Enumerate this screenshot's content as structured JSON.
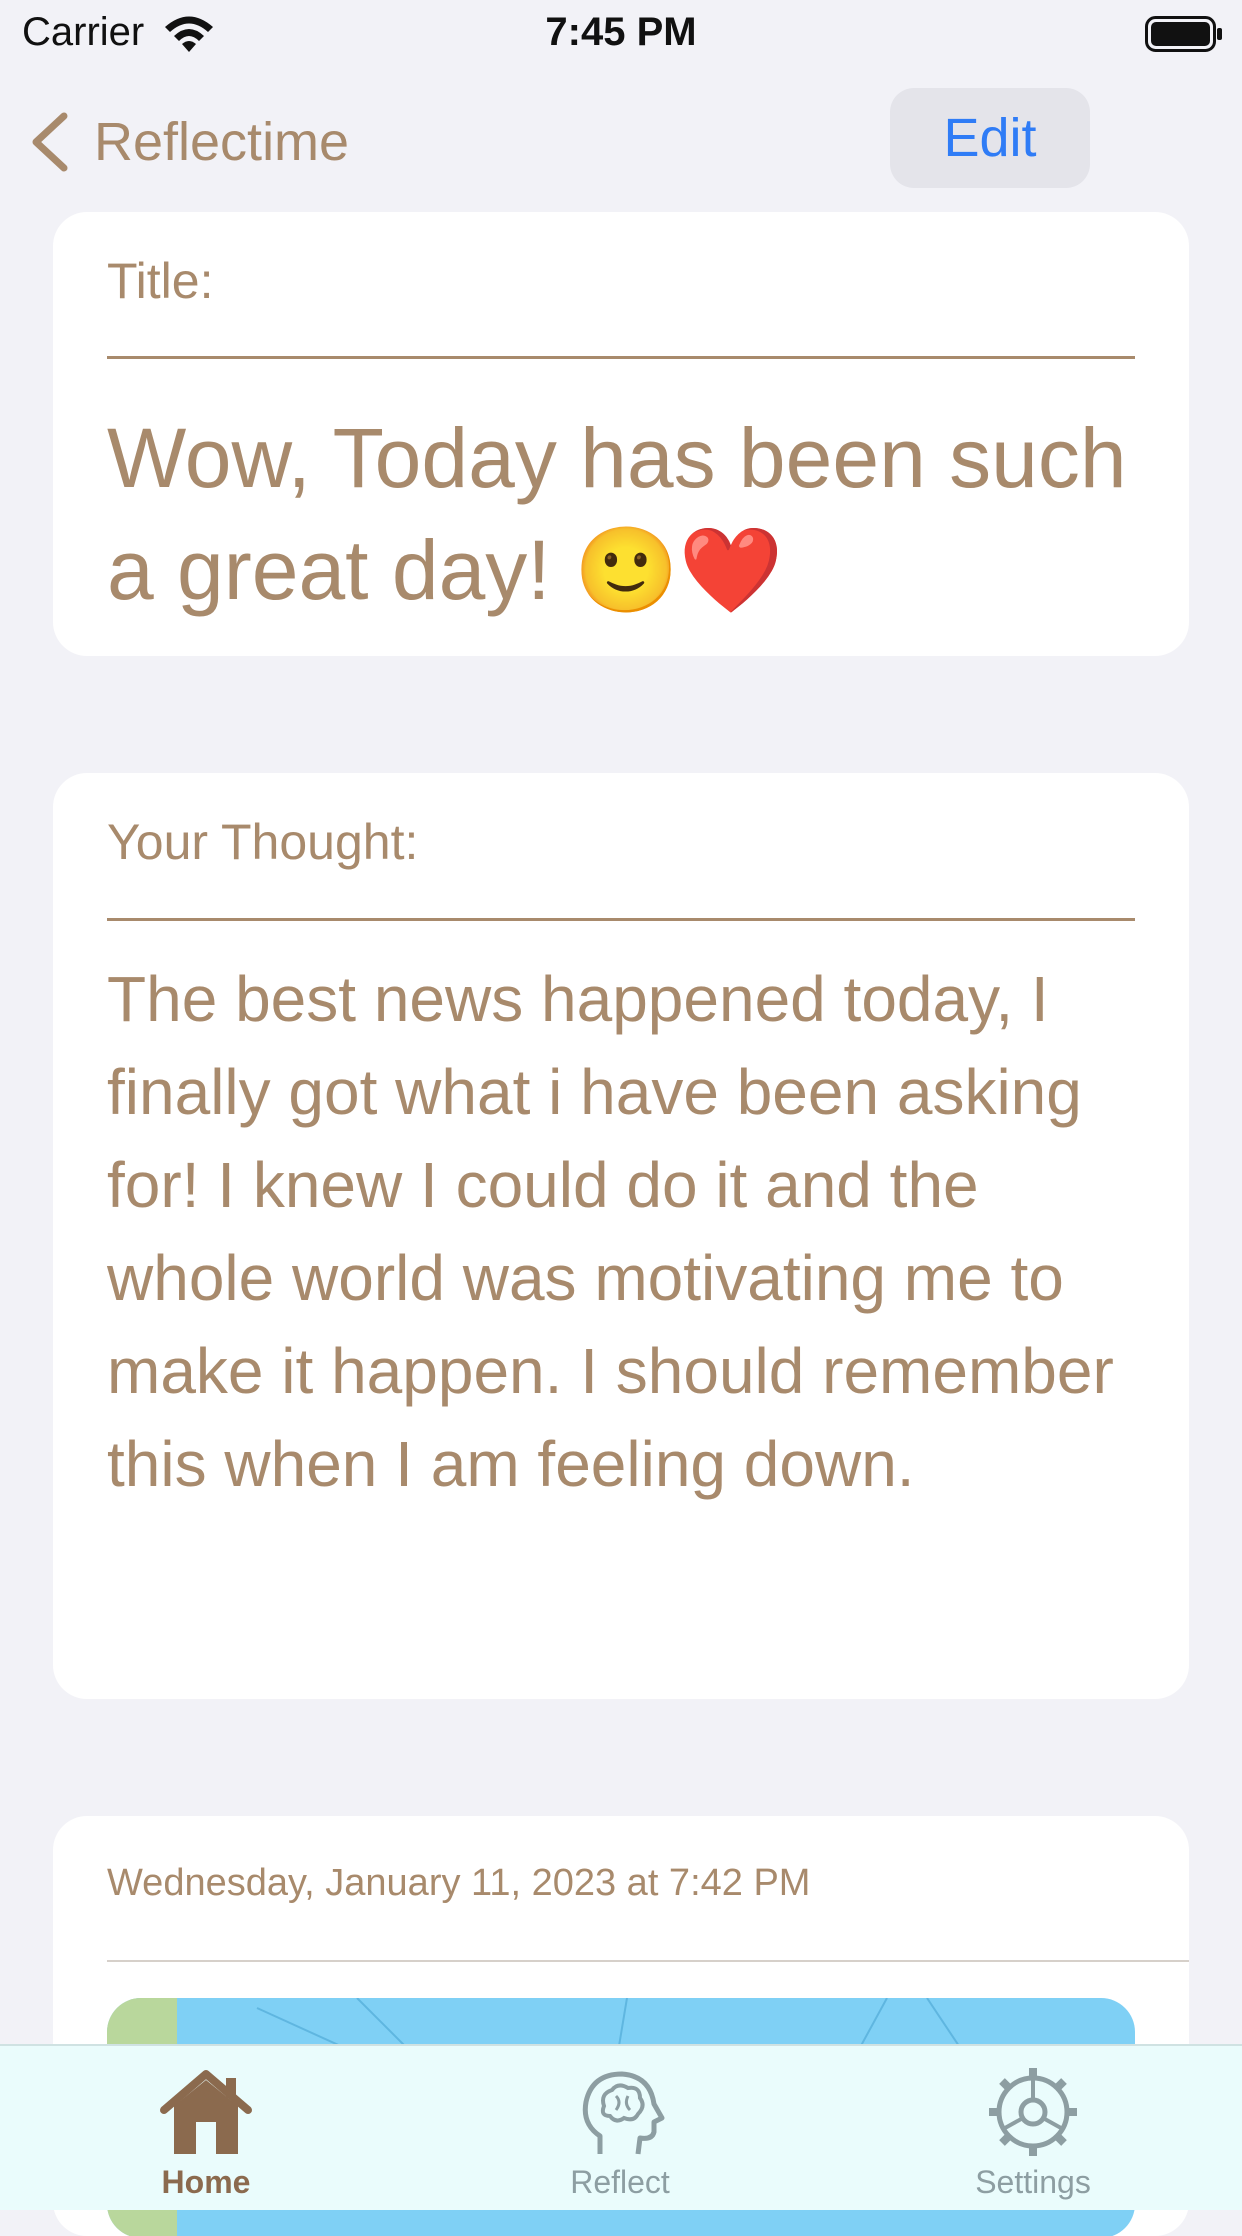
{
  "status_bar": {
    "carrier": "Carrier",
    "time": "7:45 PM",
    "wifi_icon": "wifi-icon",
    "battery_icon": "battery-full-icon"
  },
  "nav": {
    "back_label": "Reflectime",
    "back_icon": "chevron-left-icon",
    "edit_label": "Edit"
  },
  "title_card": {
    "label": "Title:",
    "value": "Wow, Today has been such a great day! 🙂❤️"
  },
  "thought_card": {
    "label": "Your Thought:",
    "value": "The best news happened today, I finally got what i have been asking for! I knew I could do it and the whole world was motivating me to make it happen. I should remember this when I am feeling down."
  },
  "date_card": {
    "date": "Wednesday, January 11, 2023 at 7:42 PM",
    "map_icon": "map-view"
  },
  "tab_bar": {
    "items": [
      {
        "label": "Home",
        "icon": "house-icon",
        "selected": true
      },
      {
        "label": "Reflect",
        "icon": "brain-head-icon",
        "selected": false
      },
      {
        "label": "Settings",
        "icon": "gear-icon",
        "selected": false
      }
    ]
  },
  "colors": {
    "accent": "#a88a6c",
    "edit_blue": "#2f7cf6",
    "background": "#f2f2f7",
    "tab_bar_bg": "#eafcfc",
    "tab_selected": "#8b6a4e",
    "tab_unselected": "#8d9ea2"
  }
}
